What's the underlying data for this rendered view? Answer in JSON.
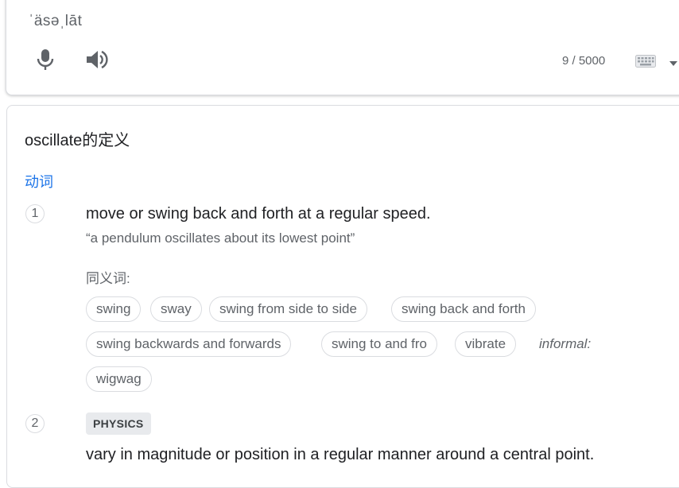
{
  "header": {
    "pronunciation": "ˈäsəˌlāt",
    "char_count": "9 / 5000",
    "icons": [
      "microphone-icon",
      "speaker-icon",
      "keyboard-icon",
      "chevron-down-icon"
    ]
  },
  "definitions": {
    "title": "oscillate的定义",
    "part_of_speech": "动词",
    "senses": [
      {
        "number": "1",
        "definition": "move or swing back and forth at a regular speed.",
        "example": "“a pendulum oscillates about its lowest point”",
        "synonyms_label": "同义词:",
        "synonyms": [
          "swing",
          "sway",
          "swing from side to side",
          "swing back and forth",
          "swing backwards and forwards",
          "swing to and fro",
          "vibrate"
        ],
        "informal_label": "informal:",
        "informal_synonyms": [
          "wigwag"
        ]
      },
      {
        "number": "2",
        "domain": "PHYSICS",
        "definition": "vary in magnitude or position in a regular manner around a central point."
      }
    ]
  },
  "colors": {
    "accent": "#1a73e8",
    "text": "#202124",
    "secondary": "#5f6368",
    "border": "#dadce0"
  }
}
